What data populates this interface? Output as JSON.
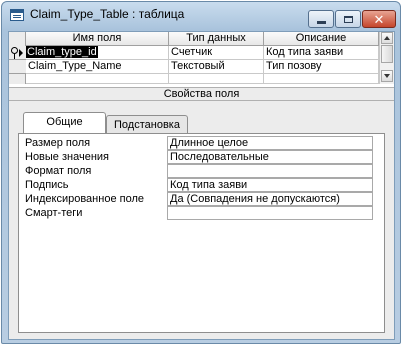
{
  "window": {
    "title": "Claim_Type_Table : таблица"
  },
  "grid": {
    "headers": [
      "Имя поля",
      "Тип данных",
      "Описание"
    ],
    "rows": [
      {
        "name": "Claim_type_id",
        "type": "Счетчик",
        "description": "Код типа заяви",
        "primary_key": true,
        "current": true
      },
      {
        "name": "Claim_Type_Name",
        "type": "Текстовый",
        "description": "Тип позову",
        "primary_key": false,
        "current": false
      }
    ]
  },
  "properties": {
    "title": "Свойства поля",
    "tabs": [
      "Общие",
      "Подстановка"
    ],
    "active_tab": "Общие",
    "rows": [
      {
        "label": "Размер поля",
        "value": "Длинное целое"
      },
      {
        "label": "Новые значения",
        "value": "Последовательные"
      },
      {
        "label": "Формат поля",
        "value": ""
      },
      {
        "label": "Подпись",
        "value": "Код типа заяви"
      },
      {
        "label": "Индексированное поле",
        "value": "Да (Совпадения не допускаются)"
      },
      {
        "label": "Смарт-теги",
        "value": ""
      }
    ]
  }
}
